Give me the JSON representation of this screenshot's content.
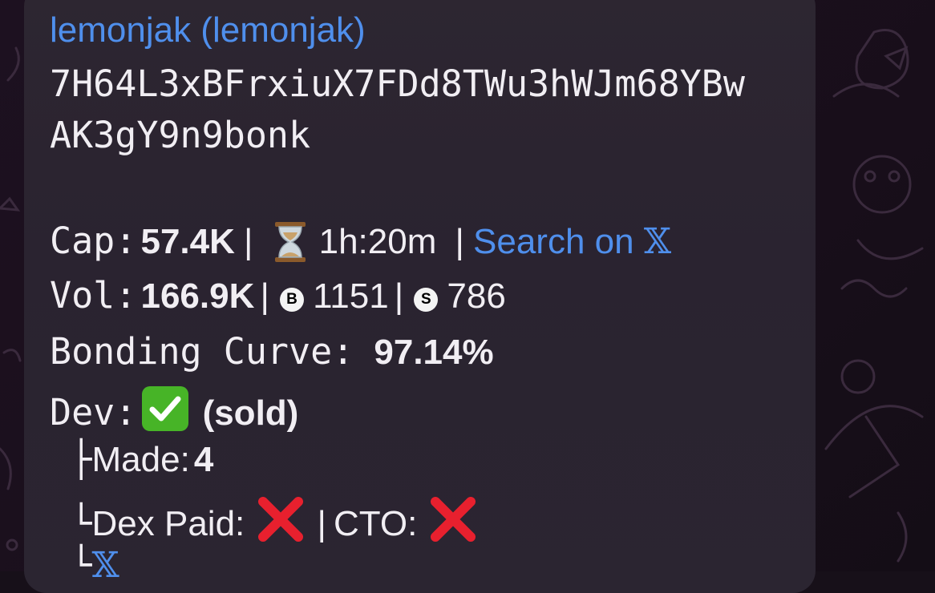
{
  "message": {
    "title_link": "lemonjak (lemonjak)",
    "address_line1": "7H64L3xBFrxiuX7FDd8TWu3hWJm68YBw",
    "address_line2": "AK3gY9n9bonk",
    "cap": {
      "label": "Cap:",
      "value": "57.4K",
      "sep": "|",
      "age": "1h:20m",
      "sep2": "|",
      "search_link": "Search on",
      "x_symbol": "𝕏"
    },
    "vol": {
      "label": "Vol:",
      "value": "166.9K",
      "sep": "|",
      "buy_badge": "B",
      "buys": "1151",
      "sep2": "|",
      "sell_badge": "S",
      "sells": "786"
    },
    "bonding": {
      "label": "Bonding Curve:",
      "value": "97.14%"
    },
    "dev": {
      "label": "Dev:",
      "status": "(sold)"
    },
    "made": {
      "prefix": "├",
      "label": "Made:",
      "value": "4"
    },
    "dex": {
      "prefix": "└",
      "label": "Dex Paid:",
      "sep": "|",
      "cto_label": "CTO:"
    },
    "last": {
      "prefix": "└",
      "x_symbol": "𝕏"
    }
  },
  "icons": [
    "hourglass-icon",
    "buy-badge-icon",
    "sell-badge-icon",
    "checkmark-icon",
    "cross-icon"
  ],
  "colors": {
    "link": "#4f8fec",
    "bubble": "#2b2531",
    "check_green": "#47b427",
    "cross_red": "#e8202e"
  }
}
